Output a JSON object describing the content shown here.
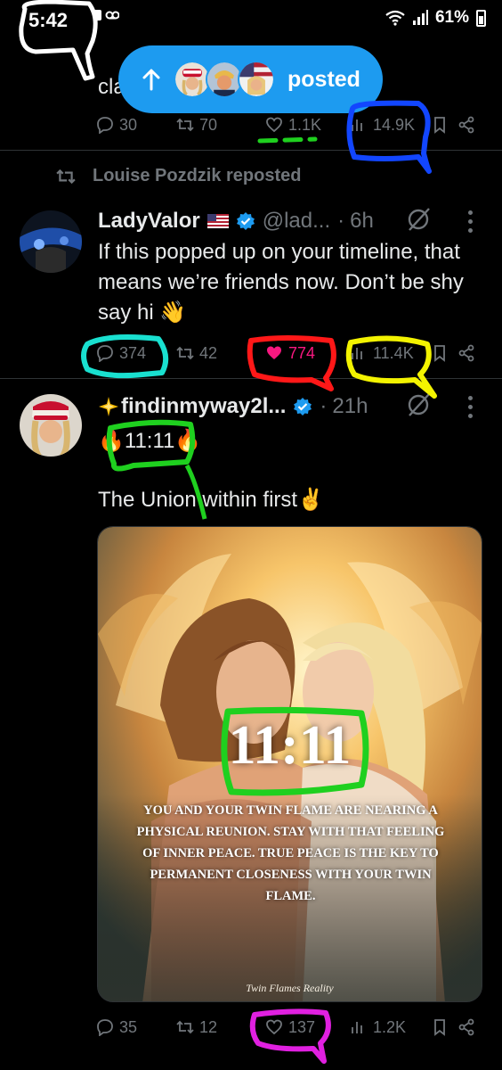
{
  "status_bar": {
    "time": "5:42",
    "battery": "61%"
  },
  "top_partial": {
    "text_line2": "cla"
  },
  "new_posts_pill": {
    "label": "posted"
  },
  "top_tweet_actions": {
    "replies": "30",
    "reposts": "70",
    "likes": "1.1K",
    "views": "14.9K"
  },
  "repost_header": {
    "label": "Louise Pozdzik reposted"
  },
  "tweet1": {
    "name": "LadyValor",
    "handle": "@lad...",
    "sep": "·",
    "time": "6h",
    "text": "If this popped up on your timeline, that means we’re friends now. Don’t be shy say hi 👋",
    "actions": {
      "replies": "374",
      "reposts": "42",
      "likes": "774",
      "views": "11.4K"
    }
  },
  "tweet2": {
    "name": "findinmyway2l...",
    "sep": "·",
    "time": "21h",
    "text_line1": "🔥11:11🔥",
    "text_line2": "The Union within first✌️",
    "media": {
      "clock": "11:11",
      "quote": "YOU AND YOUR TWIN FLAME ARE NEARING A PHYSICAL REUNION. STAY WITH THAT FEELING OF INNER PEACE. TRUE PEACE IS THE KEY TO PERMANENT CLOSENESS WITH YOUR  TWIN FLAME.",
      "credit": "Twin Flames Reality"
    },
    "actions": {
      "replies": "35",
      "reposts": "12",
      "likes": "137",
      "views": "1.2K"
    }
  },
  "colors": {
    "accent": "#1d9bf0",
    "like_pink": "#f91880",
    "muted": "#71767b",
    "text": "#e7e9ea"
  }
}
